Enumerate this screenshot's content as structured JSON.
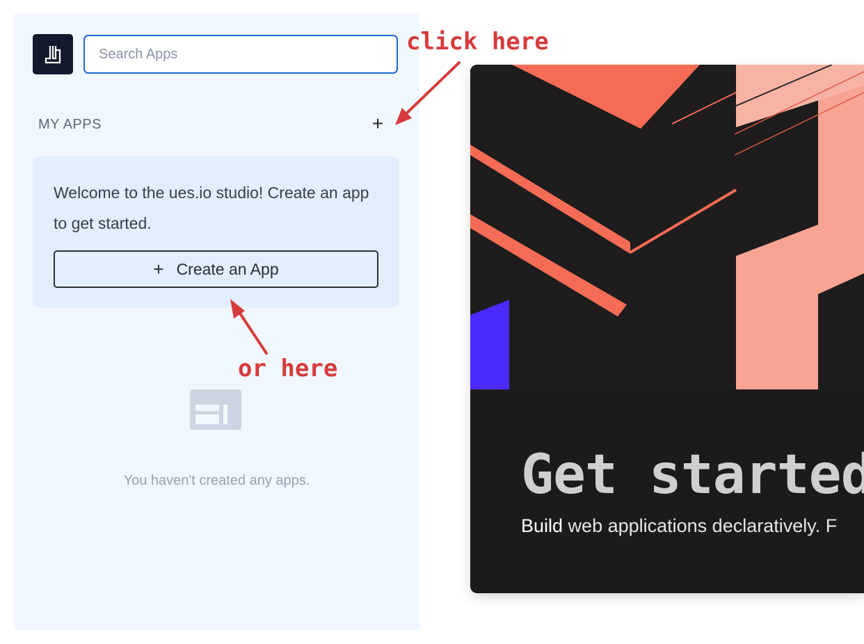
{
  "search": {
    "placeholder": "Search Apps"
  },
  "sidebar": {
    "section_title": "MY APPS",
    "add_label": "+",
    "welcome": {
      "text": "Welcome to the ues.io studio! Create an app to get started.",
      "button_label": "Create an App",
      "button_icon": "+"
    },
    "empty_state": {
      "icon": "app-placeholder-icon",
      "text": "You haven't created any apps."
    }
  },
  "hero": {
    "title": "Get started",
    "subtitle_strong": "Build",
    "subtitle_rest": " web applications declaratively. F"
  },
  "annotations": {
    "first": "click here",
    "second": "or here"
  },
  "colors": {
    "accent": "#1a6ad6",
    "annotation": "#d63b3b",
    "sidebar_bg": "#f1f7fe"
  }
}
